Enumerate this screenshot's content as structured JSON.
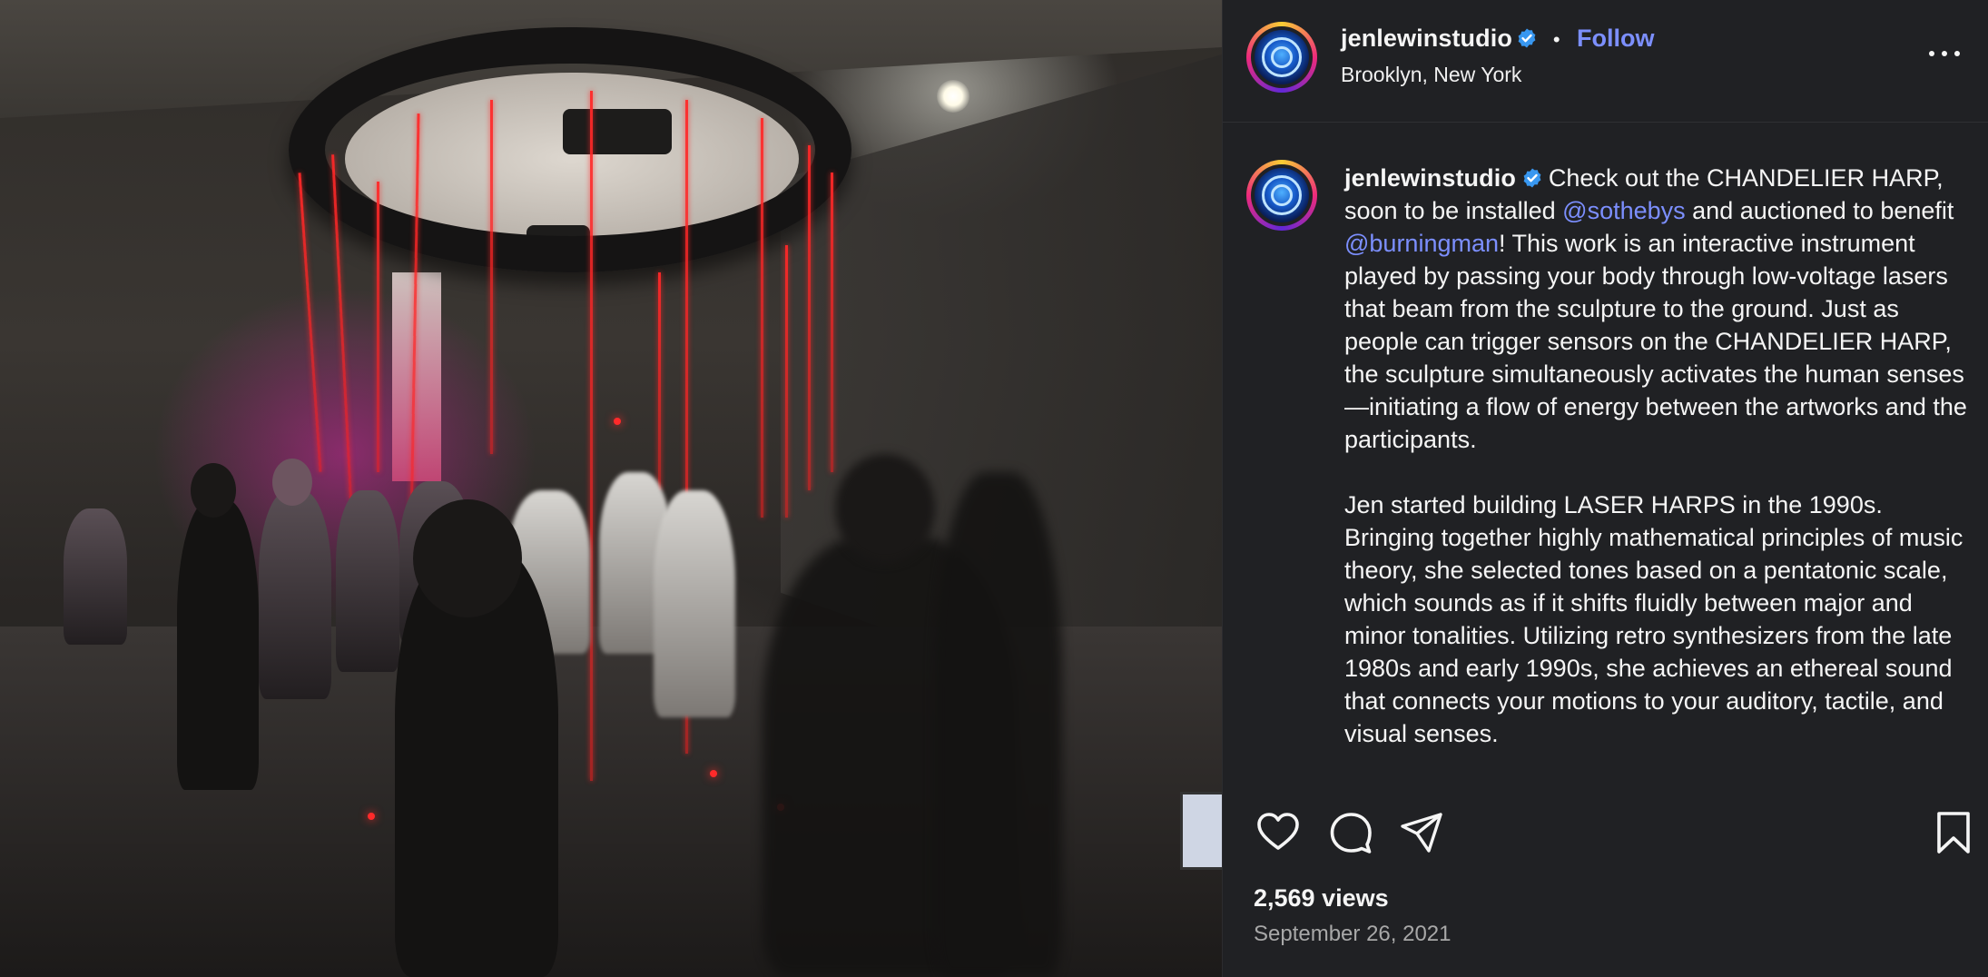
{
  "post": {
    "username": "jenlewinstudio",
    "follow_label": "Follow",
    "separator": "•",
    "location": "Brooklyn, New York",
    "caption": {
      "seg1": "Check out the CHANDELIER HARP, soon to be installed ",
      "mention1": "@sothebys",
      "seg2": " and auctioned to benefit ",
      "mention2": "@burningman",
      "seg3": "! This work is an interactive instrument played by passing your body through low-voltage lasers that beam from the sculpture to the ground. Just as people can trigger sensors on the CHANDELIER HARP, the sculpture simultaneously activates the human senses—initiating a flow of energy between the artworks and the participants.",
      "paragraph2": "Jen started building LASER HARPS in the 1990s. Bringing together highly mathematical principles of music theory, she selected tones based on a pentatonic scale, which sounds as if it shifts fluidly between major and minor tonalities. Utilizing retro synthesizers from the late 1980s and early 1990s, she achieves an ethereal sound that connects your motions to your auditory, tactile, and visual senses."
    },
    "views": "2,569 views",
    "date": "September 26, 2021"
  },
  "icons": {
    "verified": "verified-badge-icon",
    "more": "more-options-icon",
    "like": "heart-icon",
    "comment": "comment-bubble-icon",
    "share": "paper-plane-icon",
    "save": "bookmark-icon"
  },
  "colors": {
    "panel_background": "#202124",
    "link_accent": "#7c8fff",
    "verified_badge": "#3897f0",
    "secondary_text": "#a8a8a8"
  }
}
